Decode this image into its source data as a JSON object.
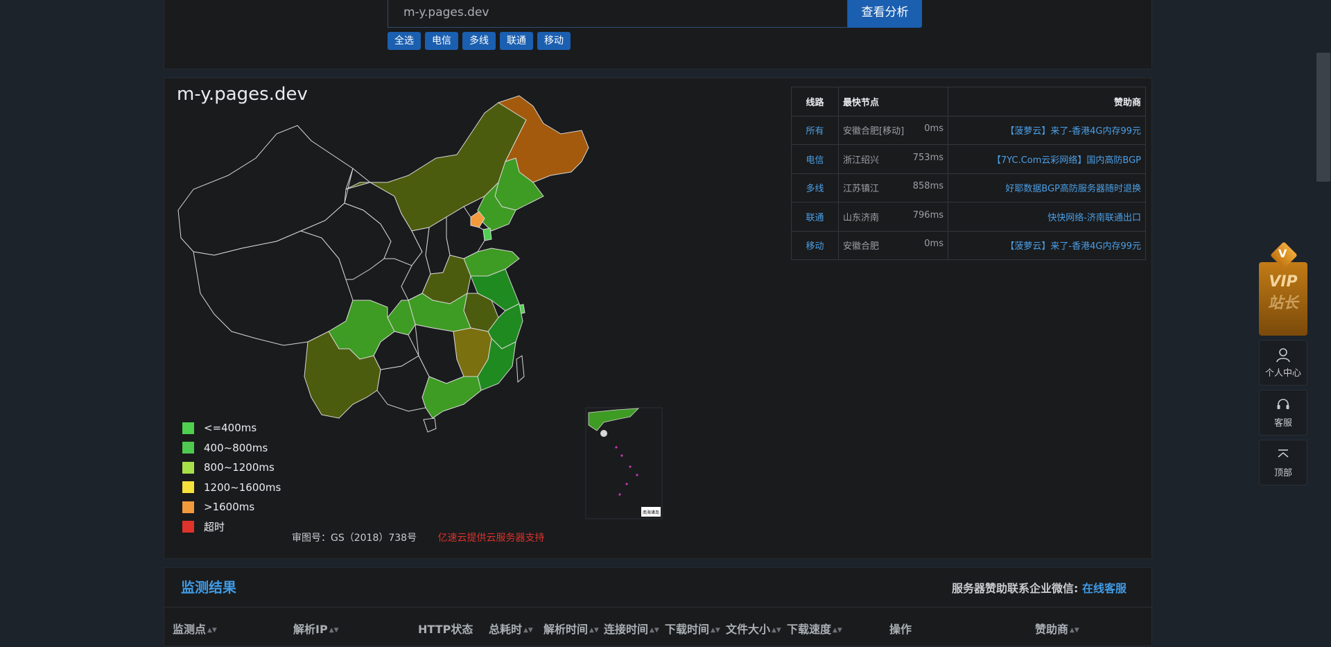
{
  "search": {
    "value": "m-y.pages.dev",
    "button_label": "查看分析"
  },
  "isp_buttons": [
    "全选",
    "电信",
    "多线",
    "联通",
    "移动"
  ],
  "map": {
    "title": "m-y.pages.dev",
    "legend": [
      {
        "label": "<=400ms",
        "color": "#4fd14f"
      },
      {
        "label": "400~800ms",
        "color": "#4fc94f"
      },
      {
        "label": "800~1200ms",
        "color": "#a8e04a"
      },
      {
        "label": "1200~1600ms",
        "color": "#f5e23a"
      },
      {
        "label": ">1600ms",
        "color": "#f39a3c"
      },
      {
        "label": "超时",
        "color": "#e0332b"
      }
    ],
    "footer_text": "审图号：GS（2018）738号",
    "footer_support": "亿速云提供云服务器支持",
    "inset_label": "南海诸岛"
  },
  "result_table": {
    "headers": [
      "线路",
      "最快节点",
      "赞助商"
    ],
    "rows": [
      {
        "line": "所有",
        "node": "安徽合肥[移动]",
        "ms": "0ms",
        "sponsor": "【菠萝云】来了-香港4G内存99元"
      },
      {
        "line": "电信",
        "node": "浙江绍兴",
        "ms": "753ms",
        "sponsor": "【7YC.Com云彩网络】国内高防BGP"
      },
      {
        "line": "多线",
        "node": "江苏镇江",
        "ms": "858ms",
        "sponsor": "好耶数据BGP高防服务器随时退换"
      },
      {
        "line": "联通",
        "node": "山东济南",
        "ms": "796ms",
        "sponsor": "快快网络-济南联通出口"
      },
      {
        "line": "移动",
        "node": "安徽合肥",
        "ms": "0ms",
        "sponsor": "【菠萝云】来了-香港4G内存99元"
      }
    ]
  },
  "float_bar": {
    "vip_letter": "V",
    "vip_text": "VIP",
    "vip_sub": "站长",
    "items": [
      {
        "label": "个人中心",
        "icon": "user-icon"
      },
      {
        "label": "客服",
        "icon": "headset-icon"
      },
      {
        "label": "顶部",
        "icon": "to-top-icon"
      }
    ]
  },
  "monitor": {
    "title": "监测结果",
    "contact_label": "服务器赞助联系企业微信:",
    "contact_link": "在线客服",
    "columns": [
      "监测点",
      "解析IP",
      "HTTP状态",
      "总耗时",
      "解析时间",
      "连接时间",
      "下载时间",
      "文件大小",
      "下载速度",
      "操作",
      "赞助商"
    ]
  }
}
